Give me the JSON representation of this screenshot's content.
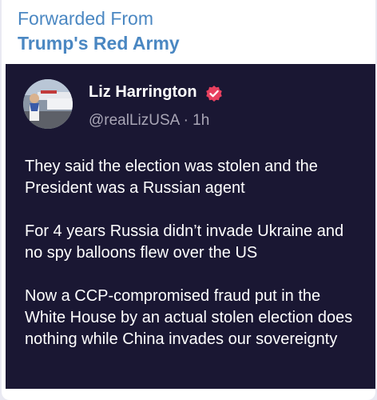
{
  "forward": {
    "prefix": "Forwarded From",
    "channel": "Trump's Red Army"
  },
  "tweet": {
    "author_name": "Liz Harrington",
    "handle": "@realLizUSA",
    "separator": "·",
    "time": "1h",
    "verified_icon": "verified-badge-icon",
    "paragraphs": [
      "They said the election was stolen and the President was a Russian agent",
      "For 4 years Russia didn’t invade Ukraine and no spy balloons flew over the US",
      "Now a CCP-compromised fraud put in the White House by an actual stolen election does nothing while China invades our sovereignty"
    ]
  },
  "colors": {
    "forward_text": "#4a87c2",
    "tweet_background": "#1a1733",
    "verified_badge": "#e8405f"
  }
}
